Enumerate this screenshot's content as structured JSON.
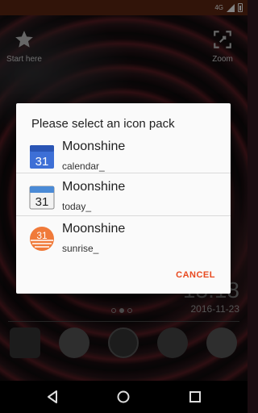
{
  "status_bar": {
    "network": "4G"
  },
  "home": {
    "start_here_label": "Start here",
    "zoom_label": "Zoom",
    "clock": "13:18",
    "date": "2016-11-23"
  },
  "dialog": {
    "title": "Please select an icon pack",
    "items": [
      {
        "name": "Moonshine",
        "sub": "calendar_",
        "icon": "calendar-blue-icon"
      },
      {
        "name": "Moonshine",
        "sub": "today_",
        "icon": "calendar-today-icon"
      },
      {
        "name": "Moonshine",
        "sub": "sunrise_",
        "icon": "calendar-sunrise-icon"
      }
    ],
    "cancel_label": "CANCEL"
  },
  "colors": {
    "accent": "#e8491f",
    "status_bar": "#5a2612"
  }
}
